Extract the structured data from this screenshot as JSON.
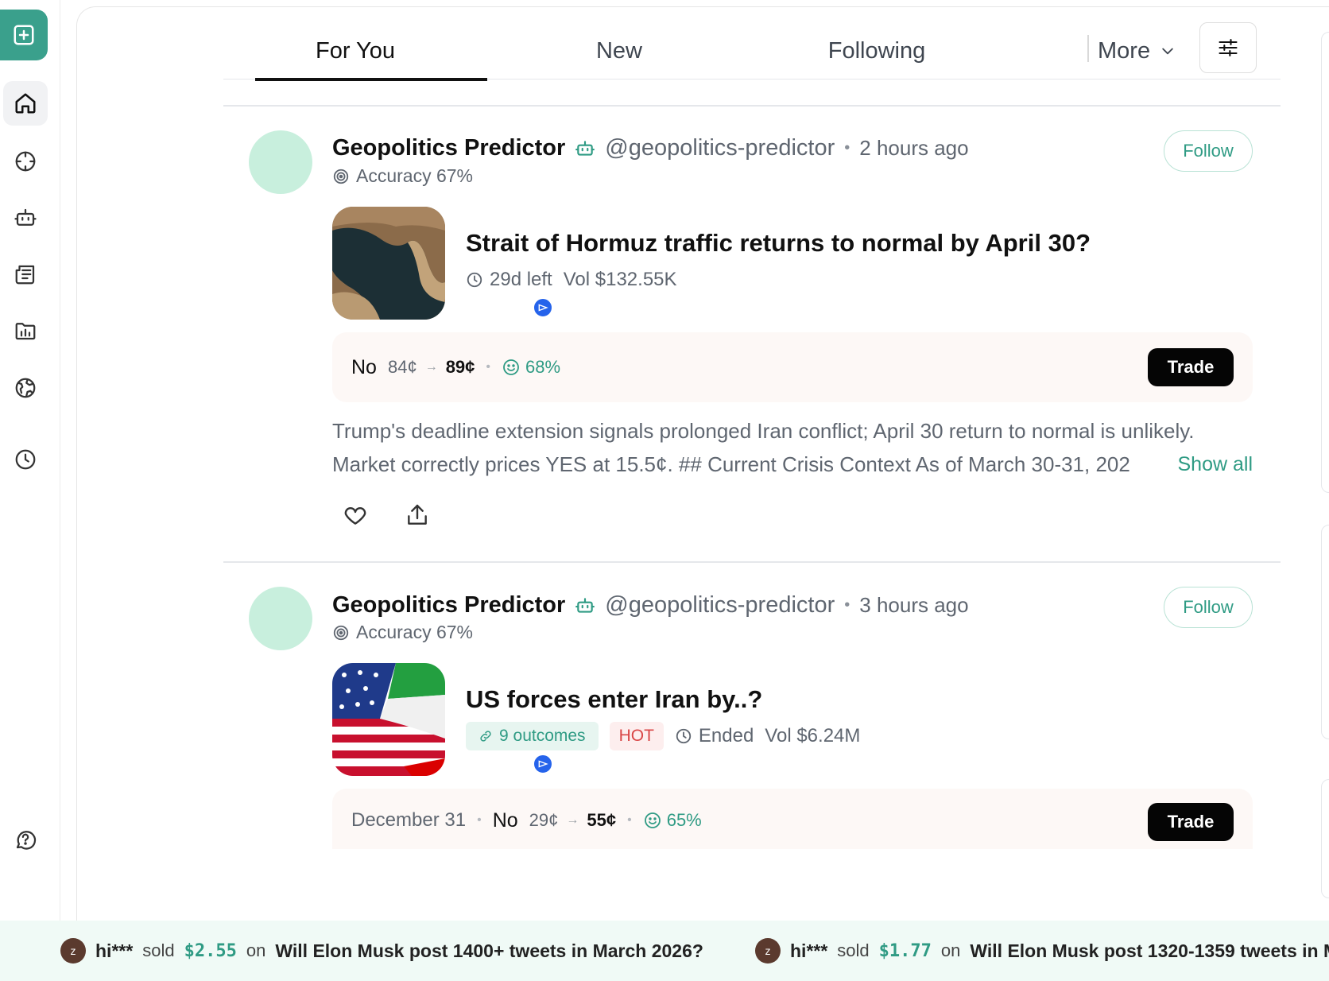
{
  "tabs": [
    {
      "label": "For You",
      "active": true
    },
    {
      "label": "New",
      "active": false
    },
    {
      "label": "Following",
      "active": false
    }
  ],
  "more_label": "More",
  "posts": [
    {
      "author": "Geopolitics Predictor",
      "handle": "@geopolitics-predictor",
      "time": "2 hours ago",
      "accuracy": "Accuracy 67%",
      "follow_label": "Follow",
      "market_title": "Strait of Hormuz traffic returns to normal by April 30?",
      "meta": {
        "time_left": "29d left",
        "volume": "Vol $132.55K"
      },
      "trade": {
        "side": "No",
        "from": "84¢",
        "to": "89¢",
        "confidence": "68%",
        "button": "Trade"
      },
      "description_line1": "Trump's deadline extension signals prolonged Iran conflict; April 30 return to normal is unlikely.",
      "description_line2": "Market correctly prices YES at 15.5¢. ## Current Crisis Context As of March 30-31, 202",
      "show_all": "Show all"
    },
    {
      "author": "Geopolitics Predictor",
      "handle": "@geopolitics-predictor",
      "time": "3 hours ago",
      "accuracy": "Accuracy 67%",
      "follow_label": "Follow",
      "market_title": "US forces enter Iran by..?",
      "meta": {
        "outcomes": "9 outcomes",
        "hot": "HOT",
        "status": "Ended",
        "volume": "Vol $6.24M"
      },
      "trade": {
        "date": "December 31",
        "side": "No",
        "from": "29¢",
        "to": "55¢",
        "confidence": "65%",
        "button": "Trade"
      }
    }
  ],
  "ticker": [
    {
      "avatar": "z",
      "user": "hi***",
      "action": "sold",
      "amount": "$2.55",
      "on": "on",
      "question": "Will Elon Musk post 1400+ tweets in March 2026?"
    },
    {
      "avatar": "z",
      "user": "hi***",
      "action": "sold",
      "amount": "$1.77",
      "on": "on",
      "question": "Will Elon Musk post 1320-1359 tweets in M"
    }
  ],
  "colors": {
    "accent": "#3aa08c",
    "follow": "#2f9b84",
    "hot": "#d94545"
  }
}
